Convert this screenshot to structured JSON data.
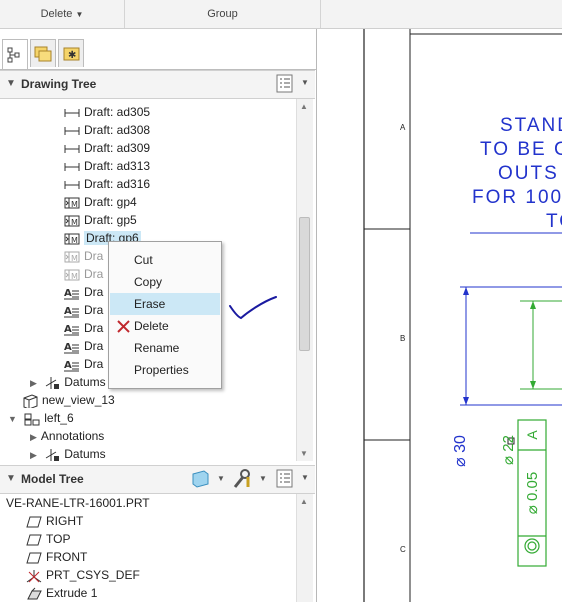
{
  "ribbon": {
    "delete_label": "Delete",
    "group_label": "Group"
  },
  "drawing_tree": {
    "title": "Drawing Tree",
    "items": [
      {
        "label": "Draft: ad305",
        "icon": "dimension-icon"
      },
      {
        "label": "Draft: ad308",
        "icon": "dimension-icon"
      },
      {
        "label": "Draft: ad309",
        "icon": "dimension-icon"
      },
      {
        "label": "Draft: ad313",
        "icon": "dimension-icon"
      },
      {
        "label": "Draft: ad316",
        "icon": "dimension-icon"
      },
      {
        "label": "Draft: gp4",
        "icon": "geometric-tolerance-icon"
      },
      {
        "label": "Draft: gp5",
        "icon": "geometric-tolerance-icon"
      },
      {
        "label": "Draft: gp6",
        "icon": "geometric-tolerance-icon"
      },
      {
        "label": "Dra",
        "icon": "geometric-tolerance-icon"
      },
      {
        "label": "Dra",
        "icon": "geometric-tolerance-icon"
      },
      {
        "label": "Dra",
        "icon": "note-icon"
      },
      {
        "label": "Dra",
        "icon": "note-icon"
      },
      {
        "label": "Dra",
        "icon": "note-icon"
      },
      {
        "label": "Dra",
        "icon": "note-icon"
      },
      {
        "label": "Dra",
        "icon": "note-icon"
      }
    ],
    "datums_label": "Datums",
    "view_label": "new_view_13",
    "left_view_label": "left_6",
    "annotations_label": "Annotations",
    "datums2_label": "Datums"
  },
  "context_menu": {
    "items": [
      "Cut",
      "Copy",
      "Erase",
      "Delete",
      "Rename",
      "Properties"
    ],
    "selected": "Erase"
  },
  "model_tree": {
    "title": "Model Tree",
    "part_name": "VE-RANE-LTR-16001.PRT",
    "items": [
      {
        "label": "RIGHT",
        "icon": "datum-plane-icon"
      },
      {
        "label": "TOP",
        "icon": "datum-plane-icon"
      },
      {
        "label": "FRONT",
        "icon": "datum-plane-icon"
      },
      {
        "label": "PRT_CSYS_DEF",
        "icon": "csys-icon"
      },
      {
        "label": "Extrude 1",
        "icon": "extrude-icon"
      }
    ]
  },
  "drawing": {
    "zone_labels": [
      "A",
      "B",
      "C"
    ],
    "note_lines": [
      "STAND",
      "TO BE C",
      "OUTS",
      "FOR 100",
      "TO"
    ],
    "dim_30": "⌀ 30",
    "dim_22": "⌀ 22",
    "tol_value": "⌀ 0.05",
    "datum_letter": "A"
  },
  "colors": {
    "selection": "#cce8f6",
    "dimension_blue": "#2233cc",
    "green": "#33aa33",
    "check_stroke": "#1a1aa0",
    "delete_red": "#c0282d"
  }
}
